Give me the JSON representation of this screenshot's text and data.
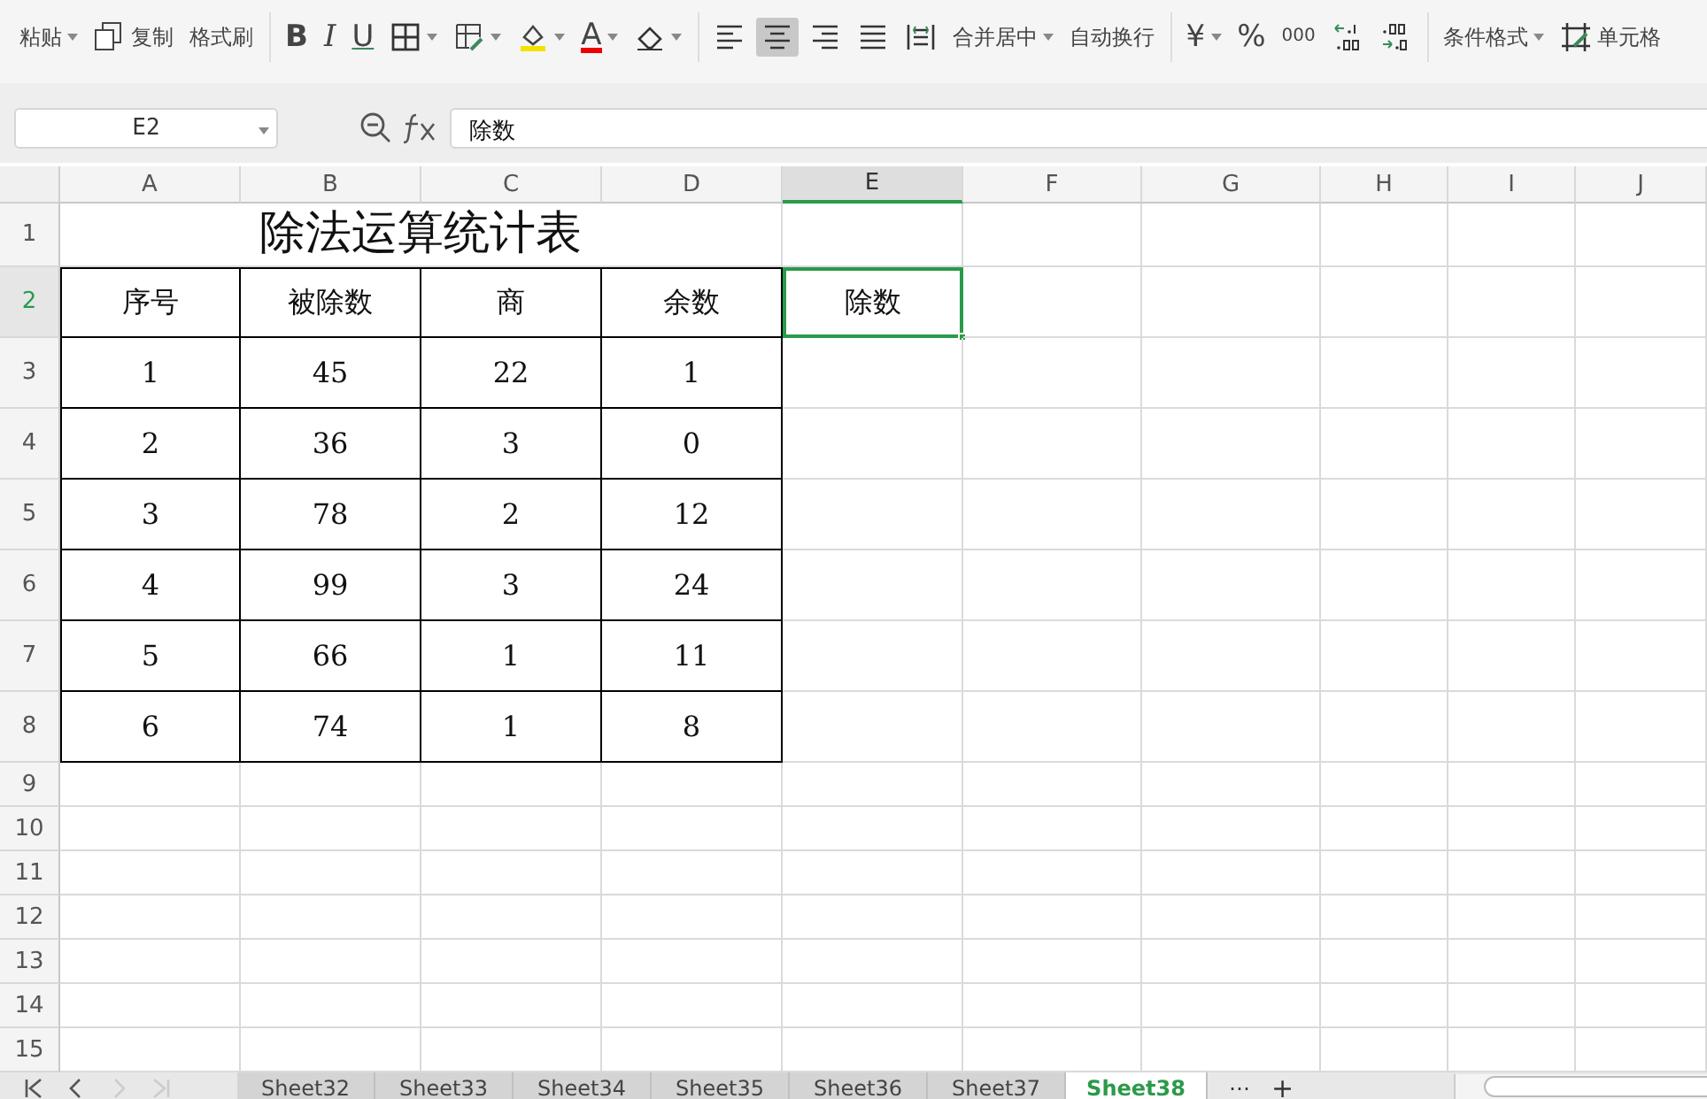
{
  "ribbon": {
    "groups": [
      {
        "items": [
          {
            "kind": "paste",
            "label": "粘贴",
            "dropdown": true
          },
          {
            "kind": "copy",
            "label": "复制",
            "dropdown": false
          },
          {
            "kind": "painter",
            "label": "格式刷",
            "dropdown": false
          }
        ]
      },
      {
        "items": [
          {
            "kind": "bold",
            "label": "B",
            "dropdown": false
          },
          {
            "kind": "italic",
            "label": "I",
            "dropdown": false
          },
          {
            "kind": "underline",
            "label": "U",
            "dropdown": false
          },
          {
            "kind": "borders",
            "dropdown": true
          },
          {
            "kind": "cellstyle",
            "dropdown": true
          },
          {
            "kind": "fill",
            "dropdown": true
          },
          {
            "kind": "fontcolor",
            "label": "A",
            "dropdown": true
          },
          {
            "kind": "eraser",
            "dropdown": true
          }
        ]
      },
      {
        "items": [
          {
            "kind": "align-left",
            "selected": false
          },
          {
            "kind": "align-center",
            "selected": true
          },
          {
            "kind": "align-right",
            "selected": false
          },
          {
            "kind": "justify",
            "selected": false
          },
          {
            "kind": "distribute",
            "selected": false
          },
          {
            "kind": "merge",
            "label": "合并居中",
            "dropdown": true
          },
          {
            "kind": "wrap",
            "label": "自动换行",
            "dropdown": false
          }
        ]
      },
      {
        "items": [
          {
            "kind": "currency",
            "label": "¥",
            "dropdown": true
          },
          {
            "kind": "percent",
            "label": "%",
            "dropdown": false
          },
          {
            "kind": "thousands",
            "label": "000",
            "dropdown": false
          },
          {
            "kind": "decimal-more",
            "dropdown": false
          },
          {
            "kind": "decimal-less",
            "dropdown": false
          }
        ]
      },
      {
        "items": [
          {
            "kind": "conditional",
            "label": "条件格式",
            "dropdown": true
          },
          {
            "kind": "cellformat",
            "label": "单元格",
            "dropdown": false
          }
        ]
      }
    ]
  },
  "formula_bar": {
    "name_box": "E2",
    "formula": "除数"
  },
  "columns": [
    {
      "label": "A",
      "selected": false
    },
    {
      "label": "B",
      "selected": false
    },
    {
      "label": "C",
      "selected": false
    },
    {
      "label": "D",
      "selected": false
    },
    {
      "label": "E",
      "selected": true
    },
    {
      "label": "F",
      "selected": false
    },
    {
      "label": "G",
      "selected": false
    },
    {
      "label": "H",
      "selected": false
    },
    {
      "label": "I",
      "selected": false
    },
    {
      "label": "J",
      "selected": false
    }
  ],
  "rows": [
    {
      "label": "1",
      "selected": false,
      "kind": "title",
      "title": "除法运算统计表"
    },
    {
      "label": "2",
      "selected": true,
      "kind": "table",
      "cells": [
        "序号",
        "被除数",
        "商",
        "余数",
        "除数"
      ]
    },
    {
      "label": "3",
      "selected": false,
      "kind": "table",
      "cells": [
        "1",
        "45",
        "22",
        "1"
      ]
    },
    {
      "label": "4",
      "selected": false,
      "kind": "table",
      "cells": [
        "2",
        "36",
        "3",
        "0"
      ]
    },
    {
      "label": "5",
      "selected": false,
      "kind": "table",
      "cells": [
        "3",
        "78",
        "2",
        "12"
      ]
    },
    {
      "label": "6",
      "selected": false,
      "kind": "table",
      "cells": [
        "4",
        "99",
        "3",
        "24"
      ]
    },
    {
      "label": "7",
      "selected": false,
      "kind": "table",
      "cells": [
        "5",
        "66",
        "1",
        "11"
      ]
    },
    {
      "label": "8",
      "selected": false,
      "kind": "table",
      "cells": [
        "6",
        "74",
        "1",
        "8"
      ]
    },
    {
      "label": "9",
      "selected": false,
      "kind": "empty"
    },
    {
      "label": "10",
      "selected": false,
      "kind": "empty"
    },
    {
      "label": "11",
      "selected": false,
      "kind": "empty"
    },
    {
      "label": "12",
      "selected": false,
      "kind": "empty"
    },
    {
      "label": "13",
      "selected": false,
      "kind": "empty"
    },
    {
      "label": "14",
      "selected": false,
      "kind": "empty"
    },
    {
      "label": "15",
      "selected": false,
      "kind": "empty"
    }
  ],
  "sheet_tabs": {
    "tabs": [
      {
        "label": "Sheet32",
        "selected": false
      },
      {
        "label": "Sheet33",
        "selected": false
      },
      {
        "label": "Sheet34",
        "selected": false
      },
      {
        "label": "Sheet35",
        "selected": false
      },
      {
        "label": "Sheet36",
        "selected": false
      },
      {
        "label": "Sheet37",
        "selected": false
      },
      {
        "label": "Sheet38",
        "selected": true
      }
    ],
    "more": "⋯",
    "add": "+"
  }
}
